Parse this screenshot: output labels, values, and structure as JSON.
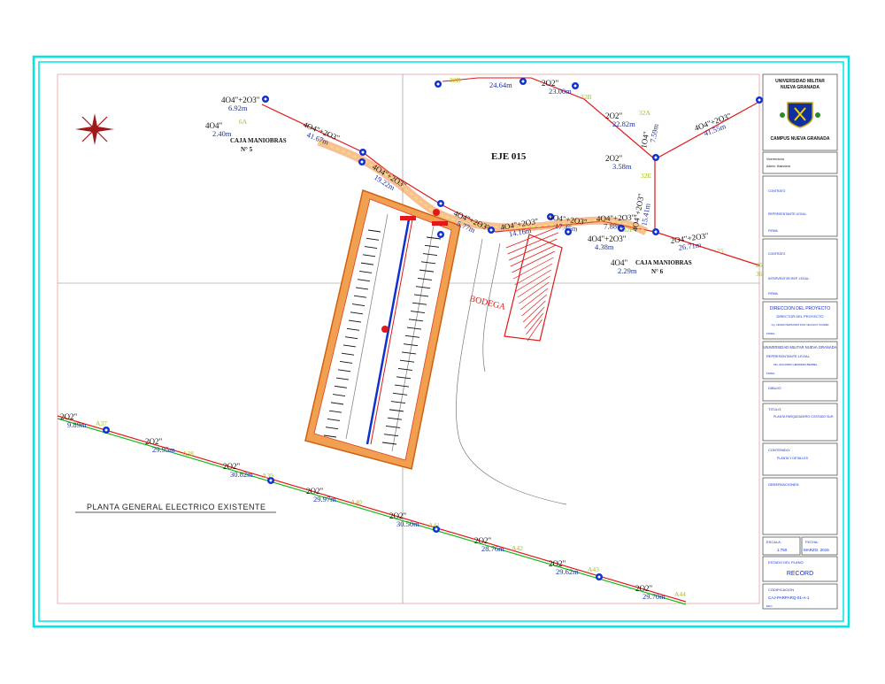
{
  "drawing_title": "PLANTA  GENERAL  ELECTRICO  EXISTENTE",
  "labels": {
    "eje": "EJE 015",
    "bodega": "BODEGA",
    "caja5_title": "CAJA MANIOBRAS",
    "caja5_num": "N° 5",
    "caja6_title": "CAJA MANIOBRAS",
    "caja6_num": "N° 6"
  },
  "cable_labels": [
    {
      "spec": "4O4\"+2O3\"",
      "len": "6.92m"
    },
    {
      "spec": "4O4\"",
      "len": "2.40m"
    },
    {
      "spec": "4O4\"+2O3\"",
      "len": "41.67m"
    },
    {
      "spec": "4O4\"+2O3\"",
      "len": "19.22m"
    },
    {
      "spec": "4O4\"+2O3\"",
      "len": "5.77m"
    },
    {
      "spec": "4O4\"+2O3\"",
      "len": "14.16m"
    },
    {
      "spec": "4O4\"+2O3\"",
      "len": "17.45m"
    },
    {
      "spec": "4O4\"+2O3\"",
      "len": "7.88m"
    },
    {
      "spec": "4O4\"+2O3\"",
      "len": "15.41m"
    },
    {
      "spec": "4O4\"+2O3\"",
      "len": "4.38m"
    },
    {
      "spec": "4O4\"",
      "len": "2.29m"
    },
    {
      "spec": "2O4\"+2O3\"",
      "len": "26.71m"
    },
    {
      "spec": "2O2\"",
      "len": "3.58m"
    },
    {
      "spec": "2O2\"",
      "len": "22.82m"
    },
    {
      "spec": "4O4\"+2O3\"",
      "len": "41.55m"
    },
    {
      "spec": "1O4\"",
      "len": "7.59m"
    },
    {
      "spec": "2O2\"",
      "len": "23.00m"
    },
    {
      "spec": "",
      "len": "24.64m"
    },
    {
      "spec": "2O2\"",
      "len": "9.89m"
    },
    {
      "spec": "2O2\"",
      "len": "29.95m"
    },
    {
      "spec": "2O2\"",
      "len": "30.82m"
    },
    {
      "spec": "2O2\"",
      "len": "29.97m"
    },
    {
      "spec": "2O2\"",
      "len": "30.50m"
    },
    {
      "spec": "2O2\"",
      "len": "28.76m"
    },
    {
      "spec": "2O2\"",
      "len": "29.62m"
    },
    {
      "spec": "2O2\"",
      "len": "29.70m"
    }
  ],
  "node_labels": [
    "6A",
    "32D",
    "32B",
    "32A",
    "32E",
    "32F",
    "25",
    "26",
    "36",
    "A37",
    "A38",
    "A39",
    "A40",
    "A41",
    "A42",
    "A43",
    "A44"
  ],
  "title_block": {
    "university": "UNIVERSIDAD MILITAR",
    "university2": "NUEVA GRANADA",
    "campus": "CAMPUS NUEVA GRANADA",
    "line1": "Vicerrectoría",
    "line2": "Admin. financiera",
    "contratista": "CONTRATO",
    "rep_legal": "REPRESENTANTE LEGAL:",
    "firma1": "FIRMA",
    "contratista2": "CONTRATO",
    "interventor": "INTERVENTOR REP. LEGAL:",
    "firma2": "FIRMA",
    "direccion": "DIRECCION DEL PROYECTO",
    "director": "DIRECTOR DEL PROYECTO",
    "director_name": "Ing. CESAR FERNANDO DIAZ VELASCO SUAREZ",
    "firma3": "FIRMA",
    "umng": "UNIVERSIDAD MILITAR NUEVA GRANADA",
    "rep_legal2": "REPRESENTANTE LEGAL",
    "rep_name": "MG. EDUARDO HERRERA BERBEL",
    "firma4": "FIRMA",
    "dibujo": "DIBUJO",
    "titulo_label": "TITULO:",
    "titulo": "PLANTA PARQUEADERO COSTADO SUR",
    "contenido_label": "CONTENIDO:",
    "contenido": "PLANTA Y DETALLES",
    "observaciones": "OBSERVACIONES:",
    "escala_label": "ESCALA:",
    "escala": "1:750",
    "fecha_label": "FECHA:",
    "fecha": "MARZO. 2015",
    "estado_label": "ESTADO DEL PLANO",
    "estado": "RECORD",
    "codificacion_label": "CODIFICACION",
    "codigo": "CAJ-PARPARQ-01-A-1",
    "ed": "EDO."
  },
  "colors": {
    "frame": "#00e5e5",
    "red_line": "#e01818",
    "green_line": "#18b818",
    "orange": "#f08a3a",
    "blue_node": "#1030d0",
    "cable_text": "#101010",
    "length_text": "#1a2fa8",
    "node_text": "#a0c020",
    "tb_text": "#1030d0"
  }
}
